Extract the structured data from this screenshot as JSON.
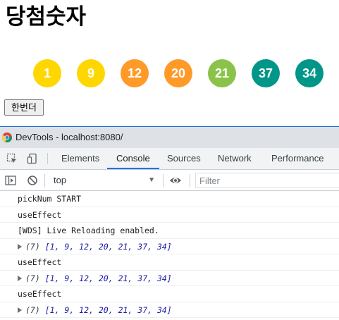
{
  "page": {
    "title": "당첨숫자",
    "redo_label": "한번더"
  },
  "balls": [
    {
      "number": "1",
      "color": "#ffd700"
    },
    {
      "number": "9",
      "color": "#ffd700"
    },
    {
      "number": "12",
      "color": "#ff9a28"
    },
    {
      "number": "20",
      "color": "#ff9a28"
    },
    {
      "number": "21",
      "color": "#8bc34a"
    },
    {
      "number": "37",
      "color": "#009688"
    },
    {
      "number": "34",
      "color": "#009688"
    }
  ],
  "devtools": {
    "window_title": "DevTools - localhost:8080/",
    "tabs": [
      "Elements",
      "Console",
      "Sources",
      "Network",
      "Performance"
    ],
    "active_tab": "Console",
    "context": "top",
    "filter_placeholder": "Filter",
    "accent": "#1a73e8",
    "logs": [
      {
        "kind": "text",
        "text": "pickNum START"
      },
      {
        "kind": "text",
        "text": "useEffect"
      },
      {
        "kind": "text",
        "text": "[WDS] Live Reloading enabled."
      },
      {
        "kind": "array",
        "length": "(7)",
        "text": "[1, 9, 12, 20, 21, 37, 34]"
      },
      {
        "kind": "text",
        "text": "useEffect"
      },
      {
        "kind": "array",
        "length": "(7)",
        "text": "[1, 9, 12, 20, 21, 37, 34]"
      },
      {
        "kind": "text",
        "text": "useEffect"
      },
      {
        "kind": "array",
        "length": "(7)",
        "text": "[1, 9, 12, 20, 21, 37, 34]"
      }
    ]
  }
}
